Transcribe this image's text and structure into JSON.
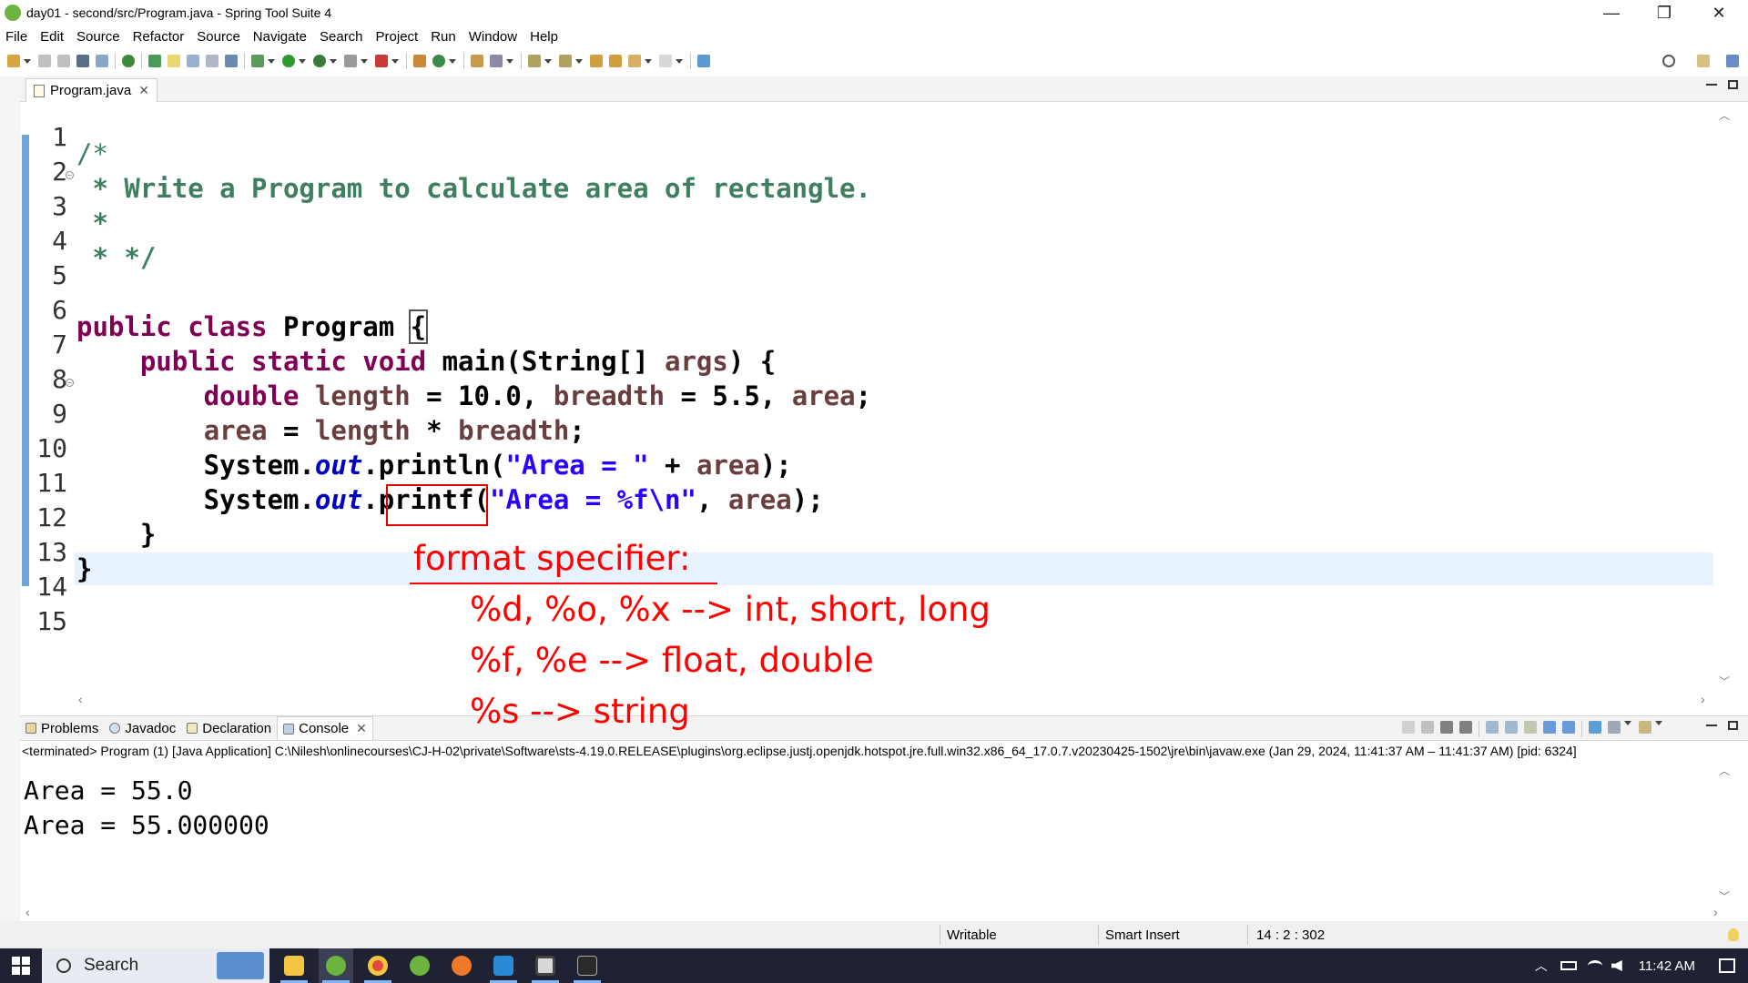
{
  "window": {
    "title": "day01 - second/src/Program.java - Spring Tool Suite 4",
    "minimize": "—",
    "restore": "❐",
    "close": "✕"
  },
  "menu": [
    "File",
    "Edit",
    "Source",
    "Refactor",
    "Source",
    "Navigate",
    "Search",
    "Project",
    "Run",
    "Window",
    "Help"
  ],
  "editor": {
    "tab_label": "Program.java",
    "line_numbers": [
      "1",
      "2",
      "3",
      "4",
      "5",
      "6",
      "7",
      "8",
      "9",
      "10",
      "11",
      "12",
      "13",
      "14",
      "15"
    ]
  },
  "code": {
    "l2": "/*",
    "l3": " * Write a Program to calculate area of rectangle.",
    "l4": " *",
    "l5": " * */",
    "l7_kw": "public class ",
    "l7_name": "Program ",
    "l7_brace": "{",
    "l8_kw": "    public static void ",
    "l8_rest": "main(String[] ",
    "l8_arg": "args",
    "l8_end": ") {",
    "l9_kw": "        double ",
    "l9_v1": "length",
    "l9_a": " = 10.0, ",
    "l9_v2": "breadth",
    "l9_b": " = 5.5, ",
    "l9_v3": "area",
    "l9_c": ";",
    "l10_indent": "        ",
    "l10_v1": "area",
    "l10_a": " = ",
    "l10_v2": "length",
    "l10_b": " * ",
    "l10_v3": "breadth",
    "l10_c": ";",
    "l11_a": "        System.",
    "l11_out": "out",
    "l11_b": ".println(",
    "l11_str": "\"Area = \"",
    "l11_c": " + ",
    "l11_v": "area",
    "l11_d": ");",
    "l12_a": "        System.",
    "l12_out": "out",
    "l12_b": ".printf(",
    "l12_str": "\"Area = %f\\n\"",
    "l12_c": ", ",
    "l12_v": "area",
    "l12_d": ");",
    "l13": "    }",
    "l14": "}"
  },
  "annotations": {
    "heading": "format specifier:",
    "line1": "%d, %o, %x --> int, short, long",
    "line2": "%f, %e --> float, double",
    "line3": "%s --> string"
  },
  "panel": {
    "tabs": [
      "Problems",
      "Javadoc",
      "Declaration",
      "Console"
    ],
    "console_info": "<terminated> Program (1) [Java Application] C:\\Nilesh\\onlinecourses\\CJ-H-02\\private\\Software\\sts-4.19.0.RELEASE\\plugins\\org.eclipse.justj.openjdk.hotspot.jre.full.win32.x86_64_17.0.7.v20230425-1502\\jre\\bin\\javaw.exe  (Jan 29, 2024, 11:41:37 AM – 11:41:37 AM) [pid: 6324]",
    "output": [
      "Area = 55.0",
      "Area = 55.000000"
    ]
  },
  "status": {
    "writable": "Writable",
    "insert_mode": "Smart Insert",
    "position": "14 : 2 : 302"
  },
  "taskbar": {
    "search_label": "Search",
    "time": "11:42 AM"
  },
  "colors": {
    "keyword": "#7f0055",
    "comment": "#3f7f5f",
    "string": "#2a00ff",
    "annotation": "#ff0000",
    "taskbar": "#1f2233"
  }
}
